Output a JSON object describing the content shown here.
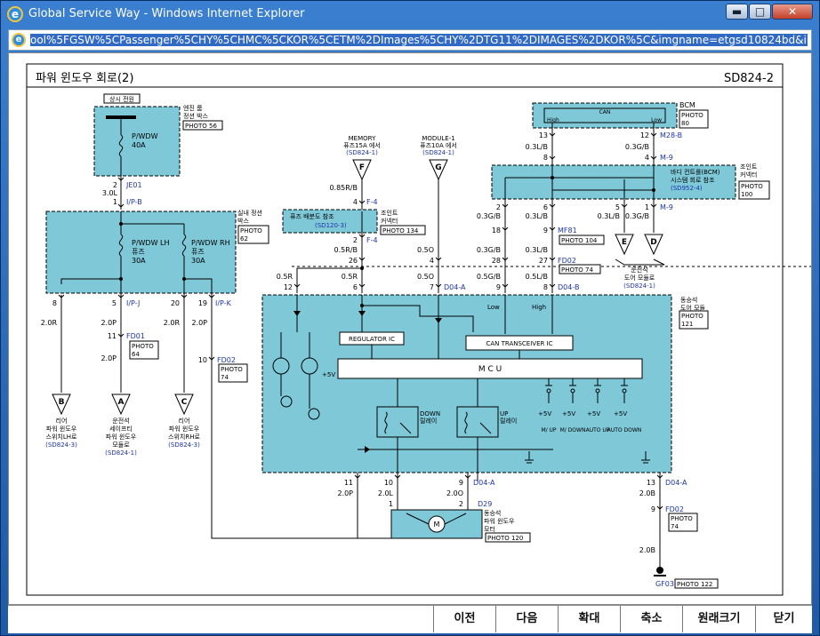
{
  "window": {
    "title": "Global Service Way - Windows Internet Explorer",
    "address": "ool%5FGSW%5CPassenger%5CHY%5CHMC%5CKOR%5CETM%2DImages%5CHY%2DTG11%2DIMAGES%2DKOR%5C&imgname=etgsd10824bd&imgext=svg",
    "minimize": "▬",
    "maximize": "□",
    "close": "✕"
  },
  "diagram": {
    "title": "파워 윈도우 회로(2)",
    "code": "SD824-2",
    "hot_at_all_times": "상시 전원",
    "engine_room_box": [
      "엔진 룸",
      "정션 박스"
    ],
    "photo_56": "PHOTO 56",
    "fuse_pwdw": "P/WDW",
    "fuse_40a": "40A",
    "je01": "JE01",
    "pin2": "2",
    "w_30l": "3.0L",
    "pin1": "1",
    "ip_b": "I/P-B",
    "indoor_box": [
      "실내 정션",
      "박스"
    ],
    "photo_62": [
      "PHOTO",
      "62"
    ],
    "fuse_lh": [
      "P/WDW LH",
      "퓨즈",
      "30A"
    ],
    "fuse_rh": [
      "P/WDW RH",
      "퓨즈",
      "30A"
    ],
    "pin8": "8",
    "pin5": "5",
    "ip_j": "I/P-J",
    "pin20": "20",
    "pin19": "19",
    "ip_k": "I/P-K",
    "w_20r": "2.0R",
    "w_20p": "2.0P",
    "w_20r2": "2.0R",
    "w_20p2": "2.0P",
    "pin11": "11",
    "fd01": "FD01",
    "photo_64": [
      "PHOTO",
      "64"
    ],
    "w_20p3": "2.0P",
    "pin10": "10",
    "fd02": "FD02",
    "photo_74": [
      "PHOTO",
      "74"
    ],
    "conn_b": "B",
    "conn_a": "A",
    "conn_c": "C",
    "label_b": [
      "리어",
      "파워 윈도우",
      "스위치LH로"
    ],
    "ref_b": "(SD824-3)",
    "label_a": [
      "운전석",
      "세이프티",
      "파워 윈도우",
      "모듈로"
    ],
    "ref_a": "(SD824-1)",
    "label_c": [
      "리어",
      "파워 윈도우",
      "스위치RH로"
    ],
    "ref_c": "(SD824-3)",
    "memory": [
      "MEMORY",
      "퓨즈15A 에서"
    ],
    "memory_ref": "(SD824-1)",
    "module1": [
      "MODULE-1",
      "퓨즈10A 에서"
    ],
    "module1_ref": "(SD824-1)",
    "conn_f": "F",
    "conn_g": "G",
    "w_085rb": "0.85R/B",
    "pin4": "4",
    "f4": "F-4",
    "joint_conn": [
      "조인트",
      "커넥터"
    ],
    "fuse_ref": "퓨즈 배분도 참조",
    "fuse_ref_code": "(SD120-3)",
    "photo_134": "PHOTO 134",
    "pin2b": "2",
    "f4b": "F-4",
    "w_05rb": "0.5R/B",
    "pin26": "26",
    "w_05o": "0.5O",
    "pin4b": "4",
    "w_05r": "0.5R",
    "w_05r2": "0.5R",
    "w_05o2": "0.5O",
    "pin12": "12",
    "pin6": "6",
    "pin7": "7",
    "d04a": "D04-A",
    "bcm": "BCM",
    "photo_80": [
      "PHOTO",
      "80"
    ],
    "can": "CAN",
    "high": "High",
    "low": "Low",
    "pin13": "13",
    "pin12b": "12",
    "m28b": "M28-B",
    "w_03lb": "0.3L/B",
    "w_03gb": "0.3G/B",
    "pin8b": "8",
    "pin4c": "4",
    "m9": "M-9",
    "body_ctrl": [
      "바디 컨트롤(BCM)",
      "시스템 회로 참조"
    ],
    "body_ref": "(SD952-4)",
    "joint_conn2": [
      "조인트",
      "커넥터"
    ],
    "photo_100": [
      "PHOTO",
      "100"
    ],
    "pin2c": "2",
    "pin6b": "6",
    "pin5b": "5",
    "pin1b": "1",
    "m9b": "M-9",
    "w_03gb2": "0.3G/B",
    "w_03lb2": "0.3L/B",
    "w_03lb3": "0.3L/B",
    "w_03gb3": "0.3G/B",
    "pin18": "18",
    "pin9": "9",
    "mf81": "MF81",
    "photo_104": "PHOTO 104",
    "conn_e": "E",
    "conn_d": "D",
    "driver_module": [
      "운전석",
      "도어 모듈로"
    ],
    "driver_ref": "(SD824-1)",
    "w_03gb4": "0.3G/B",
    "w_03lb4": "0.3L/B",
    "pin28": "28",
    "pin27": "27",
    "fd02b": "FD02",
    "photo_74b": "PHOTO 74",
    "w_05gb": "0.5G/B",
    "w_05lb": "0.5L/B",
    "pin9b": "9",
    "pin8c": "8",
    "d04b": "D04-B",
    "passenger_module": [
      "동승석",
      "도어 모듈"
    ],
    "photo_121": [
      "PHOTO",
      "121"
    ],
    "mod_low": "Low",
    "mod_high": "High",
    "regulator_ic": "REGULATOR IC",
    "can_ic": "CAN TRANSCEIVER IC",
    "mcu": "M    C    U",
    "plus5v": "+5V",
    "down_relay": [
      "DOWN",
      "릴레이"
    ],
    "up_relay": [
      "UP",
      "릴레이"
    ],
    "sw_labels": [
      "M/\nUP",
      "M/\nDOWN",
      "AUTO\nUP",
      "AUTO\nDOWN"
    ],
    "pin11b": "11",
    "w_20p4": "2.0P",
    "pin10b": "10",
    "w_20l": "2.0L",
    "pin9c": "9",
    "d04a2": "D04-A",
    "w_20o": "2.0O",
    "pin1c": "1",
    "pin2d": "2",
    "d29": "D29",
    "motor": [
      "동승석",
      "파워 윈도우",
      "모터"
    ],
    "photo_120": "PHOTO 120",
    "pin13b": "13",
    "d04a3": "D04-A",
    "w_20b": "2.0B",
    "pin9d": "9",
    "fd02c": "FD02",
    "photo_74c": [
      "PHOTO",
      "74"
    ],
    "w_20b2": "2.0B",
    "gf03": "GF03",
    "photo_122": "PHOTO 122",
    "colors": {
      "box_fill": "#7ec8d8",
      "blue_text": "#1f34a8",
      "wire": "#000000"
    }
  },
  "nav": {
    "prev": "이전",
    "next": "다음",
    "zoom": "확대",
    "shrink": "축소",
    "original": "원래크기",
    "close": "닫기"
  }
}
